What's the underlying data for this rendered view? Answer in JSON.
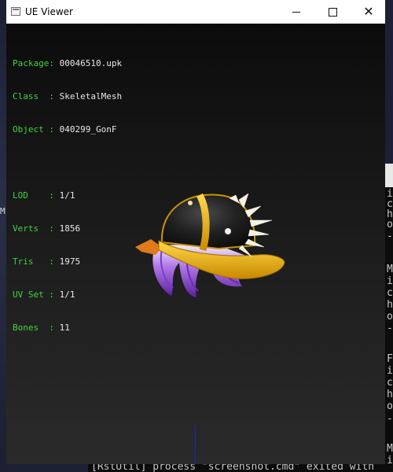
{
  "window": {
    "title": "UE Viewer",
    "minimize_glyph": "—",
    "maximize_glyph": "☐",
    "close_glyph": "✕"
  },
  "info": {
    "package": {
      "label": "Package:",
      "value": "00046510.upk"
    },
    "class": {
      "label": "Class  :",
      "value": "SkeletalMesh"
    },
    "object": {
      "label": "Object :",
      "value": "040299_GonF"
    },
    "lod": {
      "label": "LOD    :",
      "value": "1/1"
    },
    "verts": {
      "label": "Verts  :",
      "value": "1856"
    },
    "tris": {
      "label": "Tris   :",
      "value": "1975"
    },
    "uvset": {
      "label": "UV Set :",
      "value": "1/1"
    },
    "bones": {
      "label": "Bones  :",
      "value": "11"
    }
  },
  "desktop": {
    "left_glyph": "M",
    "console_lines": [
      "i",
      "c",
      "h",
      "o",
      "-",
      "",
      "M",
      "i",
      "c",
      "h",
      "o",
      "-",
      "",
      "F",
      "i",
      "c",
      "h",
      "o",
      "-",
      "",
      "M",
      "i"
    ],
    "bottom_text": "[RstUtil] process \"screenshot.cmd\" exited with"
  },
  "colors": {
    "label_green": "#3fd43f",
    "value_white": "#e8e8e8",
    "cap_black": "#1e1e1e",
    "cap_gold": "#f2b400",
    "hair_purple": "#8a3cd6",
    "axis_blue": "#2020c8"
  }
}
